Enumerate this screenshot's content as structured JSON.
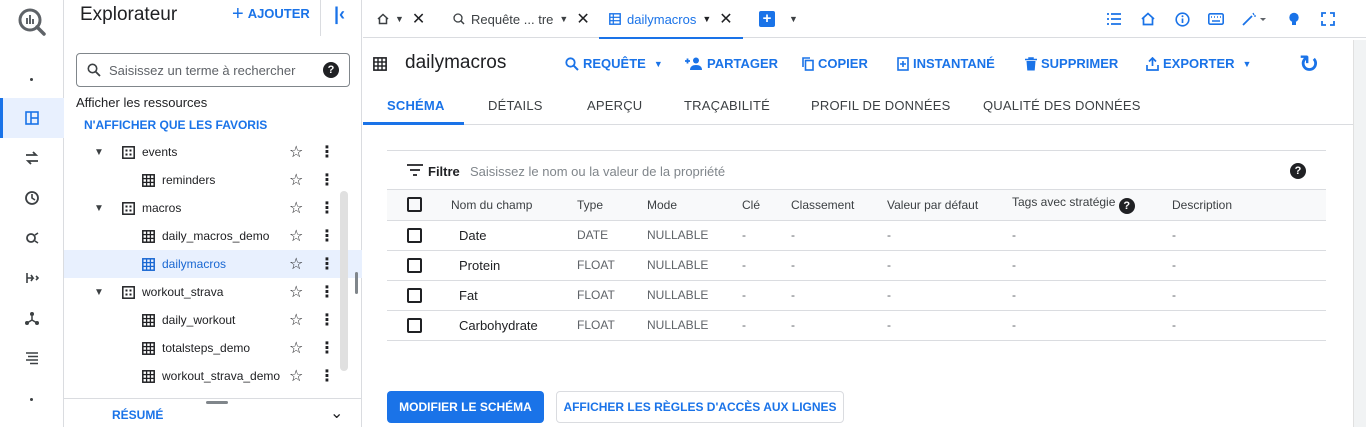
{
  "colors": {
    "accent": "#1a73e8",
    "selected_bg": "#e8f0fe",
    "text": "#202124",
    "muted": "#5f6368"
  },
  "rail": {
    "items": [
      {
        "icon": "explorer-icon"
      },
      {
        "icon": "transfers-icon"
      },
      {
        "icon": "scheduled-queries-icon"
      },
      {
        "icon": "analytics-hub-icon"
      },
      {
        "icon": "dataform-icon"
      },
      {
        "icon": "partner-center-icon"
      },
      {
        "icon": "settings-list-icon"
      }
    ]
  },
  "explorer": {
    "title": "Explorateur",
    "add_label": "AJOUTER",
    "search_placeholder": "Saisissez un terme à rechercher",
    "show_resources": "Afficher les ressources",
    "favorites_only": "N'AFFICHER QUE LES FAVORIS",
    "tree": [
      {
        "label": "events",
        "kind": "dataset",
        "level": 0,
        "selected": false
      },
      {
        "label": "reminders",
        "kind": "table",
        "level": 1,
        "selected": false
      },
      {
        "label": "macros",
        "kind": "dataset",
        "level": 0,
        "selected": false
      },
      {
        "label": "daily_macros_demo",
        "kind": "table",
        "level": 1,
        "selected": false
      },
      {
        "label": "dailymacros",
        "kind": "table",
        "level": 1,
        "selected": true
      },
      {
        "label": "workout_strava",
        "kind": "dataset",
        "level": 0,
        "selected": false
      },
      {
        "label": "daily_workout",
        "kind": "table",
        "level": 1,
        "selected": false
      },
      {
        "label": "totalsteps_demo",
        "kind": "table",
        "level": 1,
        "selected": false
      },
      {
        "label": "workout_strava_demo",
        "kind": "table",
        "level": 1,
        "selected": false
      }
    ],
    "summary_label": "RÉSUMÉ"
  },
  "tabs": {
    "items": [
      {
        "label": "",
        "icon": "home-icon"
      },
      {
        "label": "Requête ... tre",
        "icon": "query-icon"
      },
      {
        "label": "dailymacros",
        "icon": "table-icon",
        "active": true
      }
    ]
  },
  "header": {
    "table_name": "dailymacros",
    "actions": [
      {
        "label": "REQUÊTE",
        "icon": "search-icon",
        "dropdown": true
      },
      {
        "label": "PARTAGER",
        "icon": "person-add-icon",
        "dropdown": false
      },
      {
        "label": "COPIER",
        "icon": "copy-icon",
        "dropdown": false
      },
      {
        "label": "INSTANTANÉ",
        "icon": "snapshot-icon",
        "dropdown": false
      },
      {
        "label": "SUPPRIMER",
        "icon": "trash-icon",
        "dropdown": false
      },
      {
        "label": "EXPORTER",
        "icon": "export-icon",
        "dropdown": true
      }
    ]
  },
  "subtabs": [
    "SCHÉMA",
    "DÉTAILS",
    "APERÇU",
    "TRAÇABILITÉ",
    "PROFIL DE DONNÉES",
    "QUALITÉ DES DONNÉES"
  ],
  "filter": {
    "label": "Filtre",
    "placeholder": "Saisissez le nom ou la valeur de la propriété"
  },
  "schema": {
    "columns": [
      "Nom du champ",
      "Type",
      "Mode",
      "Clé",
      "Classement",
      "Valeur par défaut",
      "Tags avec stratégie",
      "Description"
    ],
    "rows": [
      {
        "name": "Date",
        "type": "DATE",
        "mode": "NULLABLE",
        "key": "-",
        "collation": "-",
        "default": "-",
        "tags": "-",
        "description": "-"
      },
      {
        "name": "Protein",
        "type": "FLOAT",
        "mode": "NULLABLE",
        "key": "-",
        "collation": "-",
        "default": "-",
        "tags": "-",
        "description": "-"
      },
      {
        "name": "Fat",
        "type": "FLOAT",
        "mode": "NULLABLE",
        "key": "-",
        "collation": "-",
        "default": "-",
        "tags": "-",
        "description": "-"
      },
      {
        "name": "Carbohydrate",
        "type": "FLOAT",
        "mode": "NULLABLE",
        "key": "-",
        "collation": "-",
        "default": "-",
        "tags": "-",
        "description": "-"
      }
    ]
  },
  "buttons": {
    "edit_schema": "MODIFIER LE SCHÉMA",
    "row_access": "AFFICHER LES RÈGLES D'ACCÈS AUX LIGNES"
  }
}
